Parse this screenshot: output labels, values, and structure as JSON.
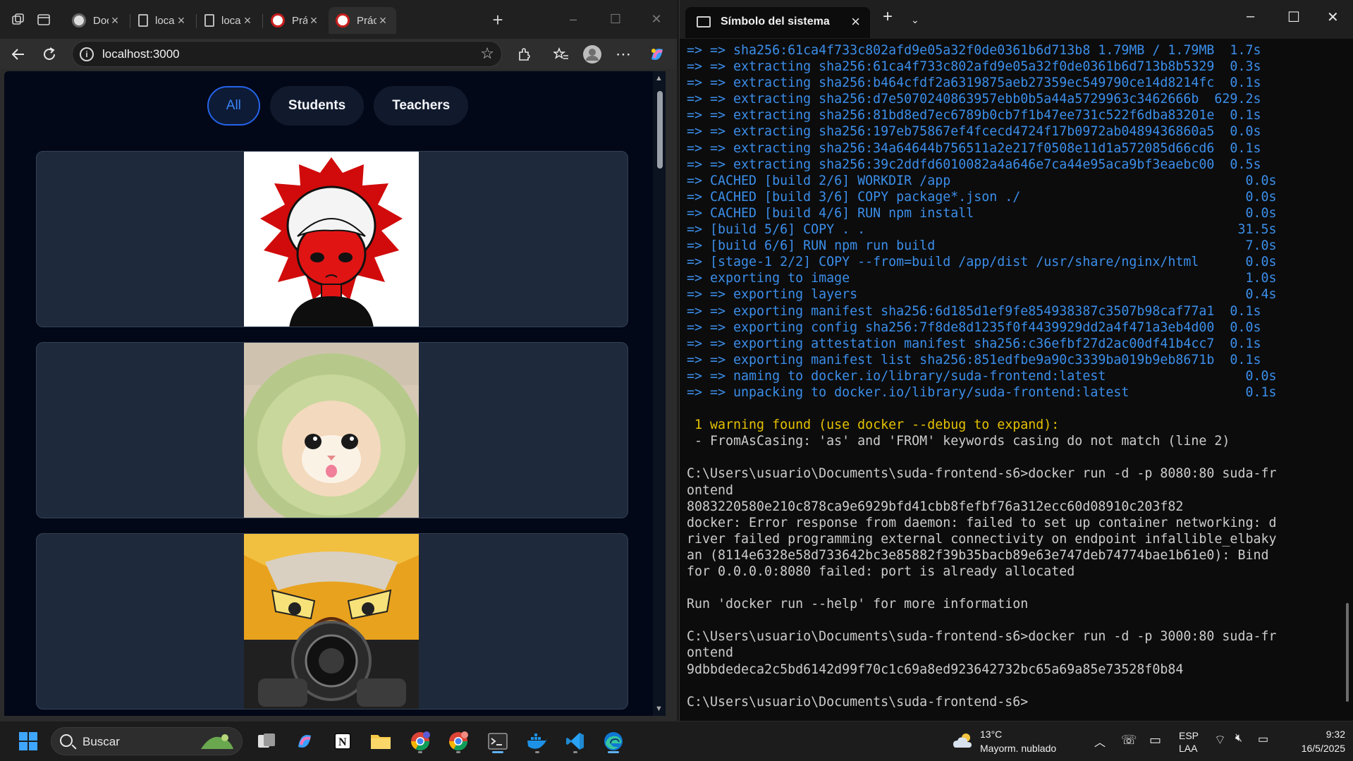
{
  "browser": {
    "tabs": [
      {
        "title": "Docker",
        "icon": "docker-favicon"
      },
      {
        "title": "localhost",
        "icon": "page-icon"
      },
      {
        "title": "localhost",
        "icon": "page-icon"
      },
      {
        "title": "Práctica",
        "icon": "app-favicon"
      },
      {
        "title": "Práctica",
        "icon": "app-favicon"
      }
    ],
    "active_tab": 4,
    "address": "localhost:3000",
    "window_controls": {
      "minimize": "–",
      "maximize": "☐",
      "close": "✕"
    }
  },
  "page": {
    "filters": [
      {
        "label": "All",
        "active": true
      },
      {
        "label": "Students",
        "active": false
      },
      {
        "label": "Teachers",
        "active": false
      }
    ],
    "cards": [
      {
        "image": "red-anime-avatar"
      },
      {
        "image": "cat-in-avocado-hat"
      },
      {
        "image": "anime-character-with-camera"
      }
    ]
  },
  "terminal": {
    "tab_title": "Símbolo del sistema",
    "lines": [
      {
        "text": "=> => sha256:61ca4f733c802afd9e05a32f0de0361b6d713b8 1.79MB / 1.79MB  1.7s",
        "color": "blue"
      },
      {
        "text": "=> => extracting sha256:61ca4f733c802afd9e05a32f0de0361b6d713b8b5329  0.3s",
        "color": "blue"
      },
      {
        "text": "=> => extracting sha256:b464cfdf2a6319875aeb27359ec549790ce14d8214fc  0.1s",
        "color": "blue"
      },
      {
        "text": "=> => extracting sha256:d7e5070240863957ebb0b5a44a5729963c3462666b  629.2s",
        "color": "blue"
      },
      {
        "text": "=> => extracting sha256:81bd8ed7ec6789b0cb7f1b47ee731c522f6dba83201e  0.1s",
        "color": "blue"
      },
      {
        "text": "=> => extracting sha256:197eb75867ef4fcecd4724f17b0972ab0489436860a5  0.0s",
        "color": "blue"
      },
      {
        "text": "=> => extracting sha256:34a64644b756511a2e217f0508e11d1a572085d66cd6  0.1s",
        "color": "blue"
      },
      {
        "text": "=> => extracting sha256:39c2ddfd6010082a4a646e7ca44e95aca9bf3eaebc00  0.5s",
        "color": "blue"
      },
      {
        "text": "=> CACHED [build 2/6] WORKDIR /app                                      0.0s",
        "color": "blue"
      },
      {
        "text": "=> CACHED [build 3/6] COPY package*.json ./                             0.0s",
        "color": "blue"
      },
      {
        "text": "=> CACHED [build 4/6] RUN npm install                                   0.0s",
        "color": "blue"
      },
      {
        "text": "=> [build 5/6] COPY . .                                                31.5s",
        "color": "blue"
      },
      {
        "text": "=> [build 6/6] RUN npm run build                                        7.0s",
        "color": "blue"
      },
      {
        "text": "=> [stage-1 2/2] COPY --from=build /app/dist /usr/share/nginx/html      0.0s",
        "color": "blue"
      },
      {
        "text": "=> exporting to image                                                   1.0s",
        "color": "blue"
      },
      {
        "text": "=> => exporting layers                                                  0.4s",
        "color": "blue"
      },
      {
        "text": "=> => exporting manifest sha256:6d185d1ef9fe854938387c3507b98caf77a1  0.1s",
        "color": "blue"
      },
      {
        "text": "=> => exporting config sha256:7f8de8d1235f0f4439929dd2a4f471a3eb4d00  0.0s",
        "color": "blue"
      },
      {
        "text": "=> => exporting attestation manifest sha256:c36efbf27d2ac00df41b4cc7  0.1s",
        "color": "blue"
      },
      {
        "text": "=> => exporting manifest list sha256:851edfbe9a90c3339ba019b9eb8671b  0.1s",
        "color": "blue"
      },
      {
        "text": "=> => naming to docker.io/library/suda-frontend:latest                  0.0s",
        "color": "blue"
      },
      {
        "text": "=> => unpacking to docker.io/library/suda-frontend:latest               0.1s",
        "color": "blue"
      },
      {
        "text": "",
        "color": "white"
      },
      {
        "text": " 1 warning found (use docker --debug to expand):",
        "color": "yellow"
      },
      {
        "text": " - FromAsCasing: 'as' and 'FROM' keywords casing do not match (line 2)",
        "color": "white"
      },
      {
        "text": "",
        "color": "white"
      },
      {
        "text": "C:\\Users\\usuario\\Documents\\suda-frontend-s6>docker run -d -p 8080:80 suda-fr",
        "color": "white"
      },
      {
        "text": "ontend",
        "color": "white"
      },
      {
        "text": "8083220580e210c878ca9e6929bfd41cbb8fefbf76a312ecc60d08910c203f82",
        "color": "white"
      },
      {
        "text": "docker: Error response from daemon: failed to set up container networking: d",
        "color": "white"
      },
      {
        "text": "river failed programming external connectivity on endpoint infallible_elbaky",
        "color": "white"
      },
      {
        "text": "an (8114e6328e58d733642bc3e85882f39b35bacb89e63e747deb74774bae1b61e0): Bind",
        "color": "white"
      },
      {
        "text": "for 0.0.0.0:8080 failed: port is already allocated",
        "color": "white"
      },
      {
        "text": "",
        "color": "white"
      },
      {
        "text": "Run 'docker run --help' for more information",
        "color": "white"
      },
      {
        "text": "",
        "color": "white"
      },
      {
        "text": "C:\\Users\\usuario\\Documents\\suda-frontend-s6>docker run -d -p 3000:80 suda-fr",
        "color": "white"
      },
      {
        "text": "ontend",
        "color": "white"
      },
      {
        "text": "9dbbdedeca2c5bd6142d99f70c1c69a8ed923642732bc65a69a85e73528f0b84",
        "color": "white"
      },
      {
        "text": "",
        "color": "white"
      },
      {
        "text": "C:\\Users\\usuario\\Documents\\suda-frontend-s6>",
        "color": "white"
      }
    ]
  },
  "taskbar": {
    "search_label": "Buscar",
    "weather_temp": "13°C",
    "weather_desc": "Mayorm. nublado",
    "lang_1": "ESP",
    "lang_2": "LAA",
    "time": "9:32",
    "date": "16/5/2025"
  },
  "colors": {
    "accent": "#2563eb",
    "page_bg": "#020817",
    "card_bg": "#1e293b",
    "terminal_blue": "#3b8eea",
    "terminal_yellow": "#e5c100"
  }
}
